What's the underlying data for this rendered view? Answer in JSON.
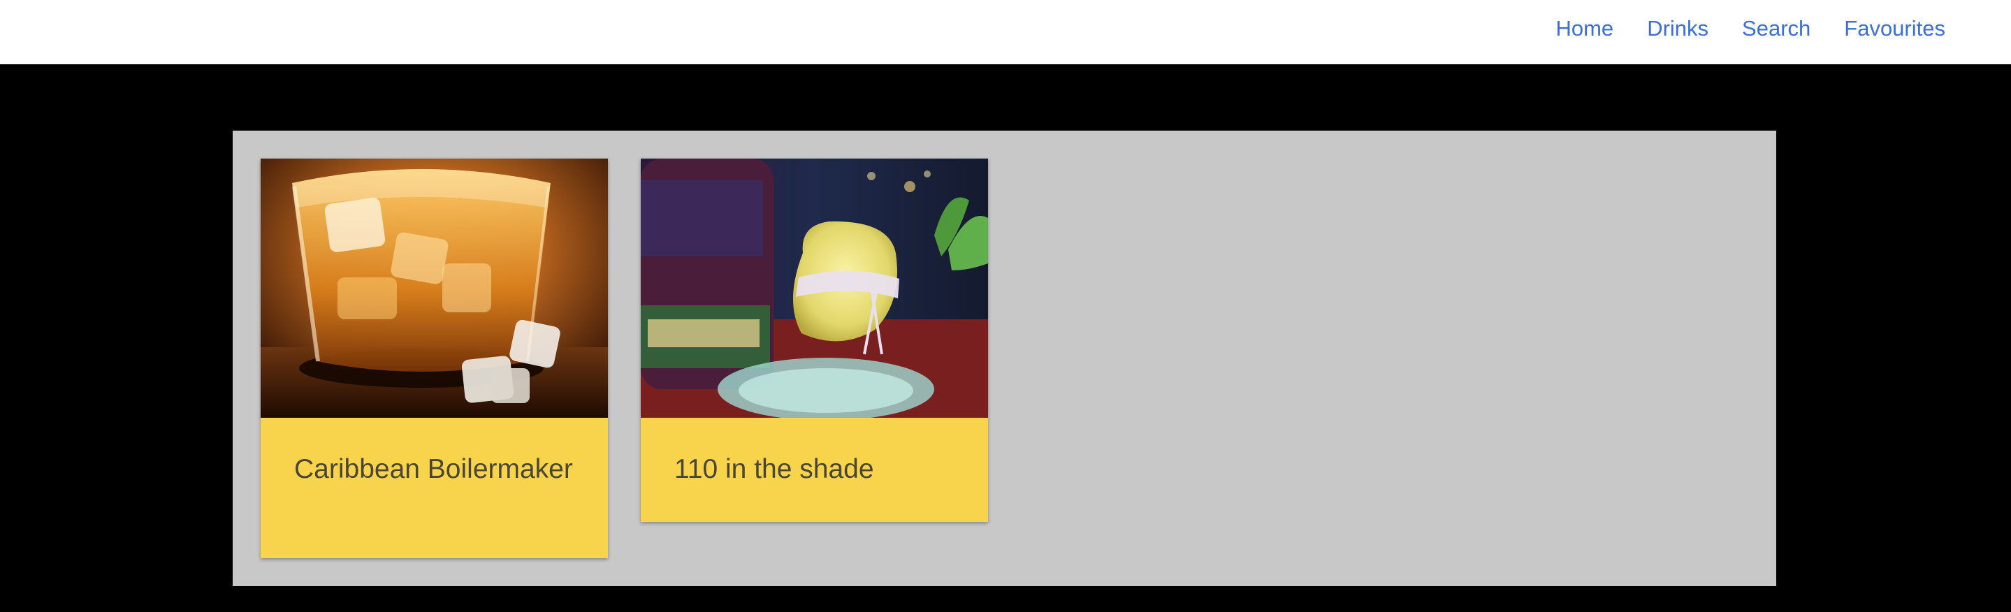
{
  "nav": {
    "links": [
      "Home",
      "Drinks",
      "Search",
      "Favourites"
    ]
  },
  "drinks": [
    {
      "name": "Caribbean Boilermaker",
      "image": "glass-of-whiskey-on-ice"
    },
    {
      "name": "110 in the shade",
      "image": "yellow-cocktail-with-mint-and-bottle"
    }
  ],
  "colors": {
    "nav_link": "#3b6fd1",
    "card_background": "#f8d44c",
    "panel_background": "#c8c8c8",
    "page_background": "#000000"
  }
}
